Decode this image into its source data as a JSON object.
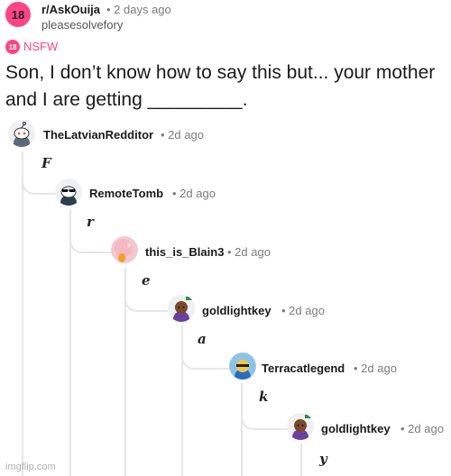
{
  "post": {
    "sub_icon_text": "18",
    "subreddit": "r/AskOuija",
    "time": "• 2 days ago",
    "poster": "pleasesolvefory",
    "nsfw_badge": "18",
    "nsfw_label": "NSFW",
    "title": "Son, I don’t know how to say this but... your mother and I are getting _________."
  },
  "comments": [
    {
      "user": "TheLatvianRedditor",
      "time": "• 2d ago",
      "letter": "F",
      "avatar": "snoo-avatar"
    },
    {
      "user": "RemoteTomb",
      "time": "• 2d ago",
      "letter": "r",
      "avatar": "sunglasses-snoo-avatar"
    },
    {
      "user": "this_is_Blain3",
      "time": "• 2d ago",
      "letter": "e",
      "avatar": "pink-blob-avatar"
    },
    {
      "user": "goldlightkey",
      "time": "• 2d ago",
      "letter": "a",
      "avatar": "purple-character-avatar"
    },
    {
      "user": "Terracatlegend",
      "time": "• 2d ago",
      "letter": "k",
      "avatar": "yellow-character-avatar"
    },
    {
      "user": "goldlightkey",
      "time": "• 2d ago",
      "letter": "y",
      "avatar": "purple-character-avatar"
    }
  ],
  "watermark": "imgflip.com",
  "colors": {
    "brand": "#ff4585",
    "thread_line": "#e6e6e6",
    "meta": "#7c7c7c"
  }
}
